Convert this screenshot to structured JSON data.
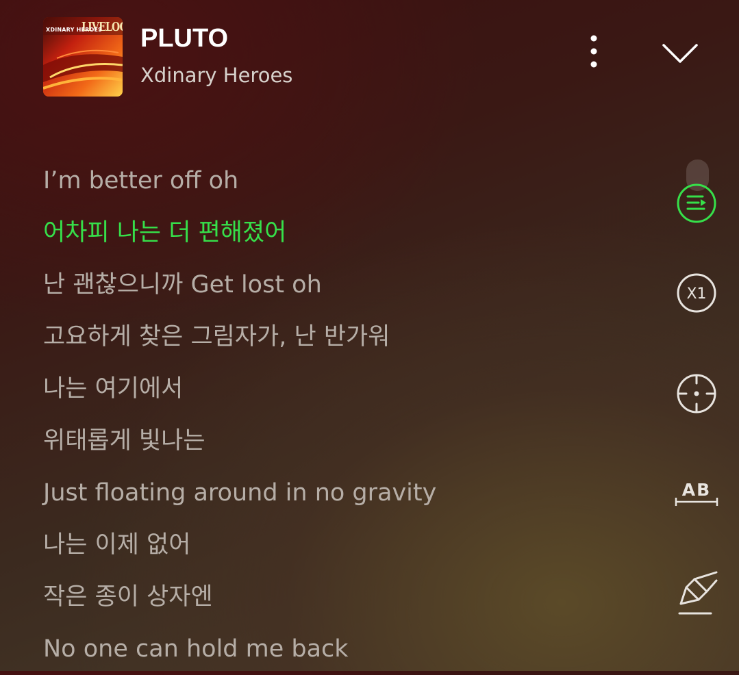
{
  "header": {
    "title": "PLUTO",
    "artist": "Xdinary Heroes",
    "album_art_logo": "LIVELOCK",
    "album_art_band": "XDINARY HEROES"
  },
  "lyrics": {
    "current_index": 1,
    "lines": [
      "I’m better off oh",
      "어차피 나는 더 편해졌어",
      "난 괜찮으니까 Get lost oh",
      "고요하게 찾은 그림자가, 난 반가워",
      "나는 여기에서",
      "위태롭게 빛나는",
      "Just floating around in no gravity",
      "나는 이제 없어",
      "작은 종이 상자엔",
      "No one can hold me back"
    ]
  },
  "tools": {
    "speed_label": "X1",
    "ab_label": "AB"
  },
  "colors": {
    "active_lyric": "#36e04a",
    "inactive_lyric": "#b6aea7",
    "icon": "#e8e4df"
  },
  "icons": [
    "more-vertical-icon",
    "chevron-down-icon",
    "playlist-icon",
    "speed-icon",
    "locate-icon",
    "ab-repeat-icon",
    "highlighter-icon"
  ]
}
